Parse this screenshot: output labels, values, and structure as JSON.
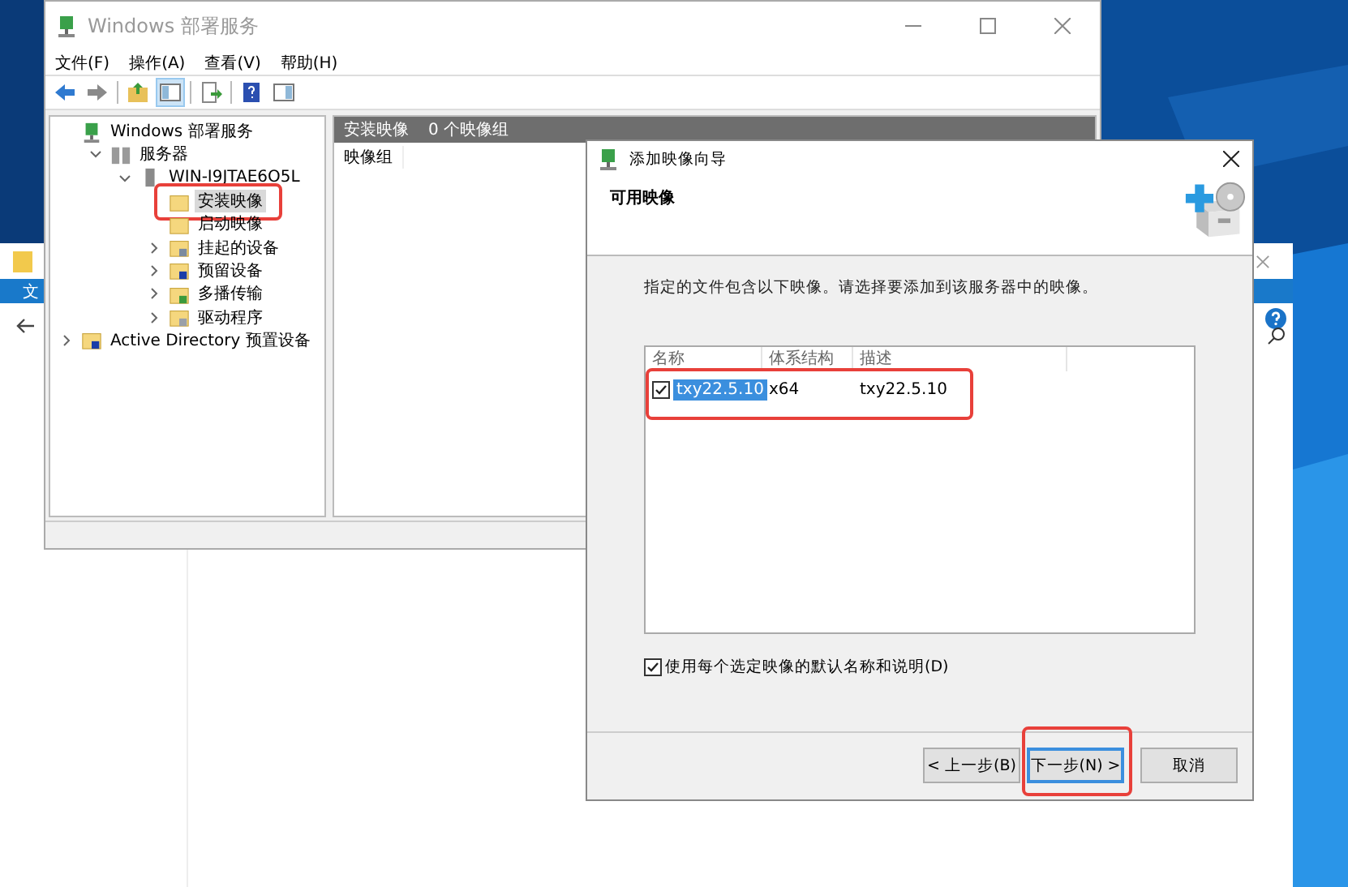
{
  "back_window": {
    "ribbon_tab": "文"
  },
  "main_window": {
    "title": "Windows 部署服务",
    "menu": [
      "文件(F)",
      "操作(A)",
      "查看(V)",
      "帮助(H)"
    ],
    "tree": [
      {
        "label": "Windows 部署服务",
        "kind": "wds",
        "selected": false,
        "children": [
          {
            "label": "服务器",
            "kind": "servers",
            "expanded": true,
            "selected": false,
            "children": [
              {
                "label": "WIN-I9JTAE6O5L",
                "kind": "server",
                "expanded": true,
                "selected": false,
                "children": [
                  {
                    "label": "安装映像",
                    "kind": "folder",
                    "selected": true,
                    "highlight": true
                  },
                  {
                    "label": "启动映像",
                    "kind": "folder",
                    "selected": false
                  },
                  {
                    "label": "挂起的设备",
                    "kind": "pending",
                    "expanded": false,
                    "selected": false
                  },
                  {
                    "label": "预留设备",
                    "kind": "reserved",
                    "expanded": false,
                    "selected": false
                  },
                  {
                    "label": "多播传输",
                    "kind": "multicast",
                    "expanded": false,
                    "selected": false
                  },
                  {
                    "label": "驱动程序",
                    "kind": "drivers",
                    "expanded": false,
                    "selected": false
                  }
                ]
              }
            ]
          }
        ]
      },
      {
        "label": "Active Directory 预置设备",
        "kind": "ad",
        "expanded": false,
        "selected": false
      }
    ],
    "pane": {
      "header": "安装映像",
      "count": "0 个映像组",
      "columns": [
        "映像组"
      ]
    }
  },
  "dialog": {
    "title": "添加映像向导",
    "heading": "可用映像",
    "instruction": "指定的文件包含以下映像。请选择要添加到该服务器中的映像。",
    "columns": [
      "名称",
      "体系结构",
      "描述"
    ],
    "rows": [
      {
        "checked": true,
        "selected": true,
        "highlight": true,
        "cells": [
          "txy22.5.10",
          "x64",
          "txy22.5.10"
        ]
      }
    ],
    "option": {
      "label": "使用每个选定映像的默认名称和说明(D)",
      "checked": true
    },
    "buttons": [
      {
        "label": "< 上一步(B)",
        "focused": false
      },
      {
        "label": "下一步(N) >",
        "focused": true,
        "highlight": true
      },
      {
        "label": "取消",
        "focused": false
      }
    ]
  }
}
